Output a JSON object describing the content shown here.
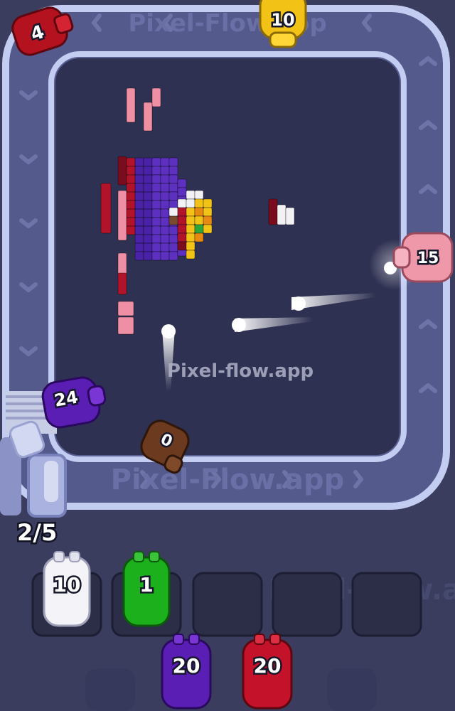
{
  "watermark": {
    "text": "Pixel-flow.app",
    "track_text": "Pixel-Flow.app"
  },
  "queue_counter": "2/5",
  "colors": {
    "background": "#3a3d5e",
    "board": "#2f3152",
    "track": "#5a5f91",
    "track_rail": "#b9c3ee"
  },
  "conveyor_pigs": [
    {
      "id": "red",
      "count": "4",
      "color": "#b3121e"
    },
    {
      "id": "yellow",
      "count": "10",
      "color": "#f2c316"
    },
    {
      "id": "pink",
      "count": "15",
      "color": "#ef98aa"
    },
    {
      "id": "purple",
      "count": "24",
      "color": "#5a1eb4"
    },
    {
      "id": "brown",
      "count": "0",
      "color": "#6b3a1f"
    }
  ],
  "holding_slots": [
    {
      "count": "10",
      "color": "#f4f4f8",
      "text_color": "#ffffff"
    },
    {
      "count": "1",
      "color": "#1db01d"
    },
    {
      "count": "",
      "color": ""
    },
    {
      "count": "",
      "color": ""
    },
    {
      "count": "",
      "color": ""
    }
  ],
  "queue_pigs": [
    {
      "count": "20",
      "color": "#5a1eb4"
    },
    {
      "count": "20",
      "color": "#c4122a"
    }
  ]
}
